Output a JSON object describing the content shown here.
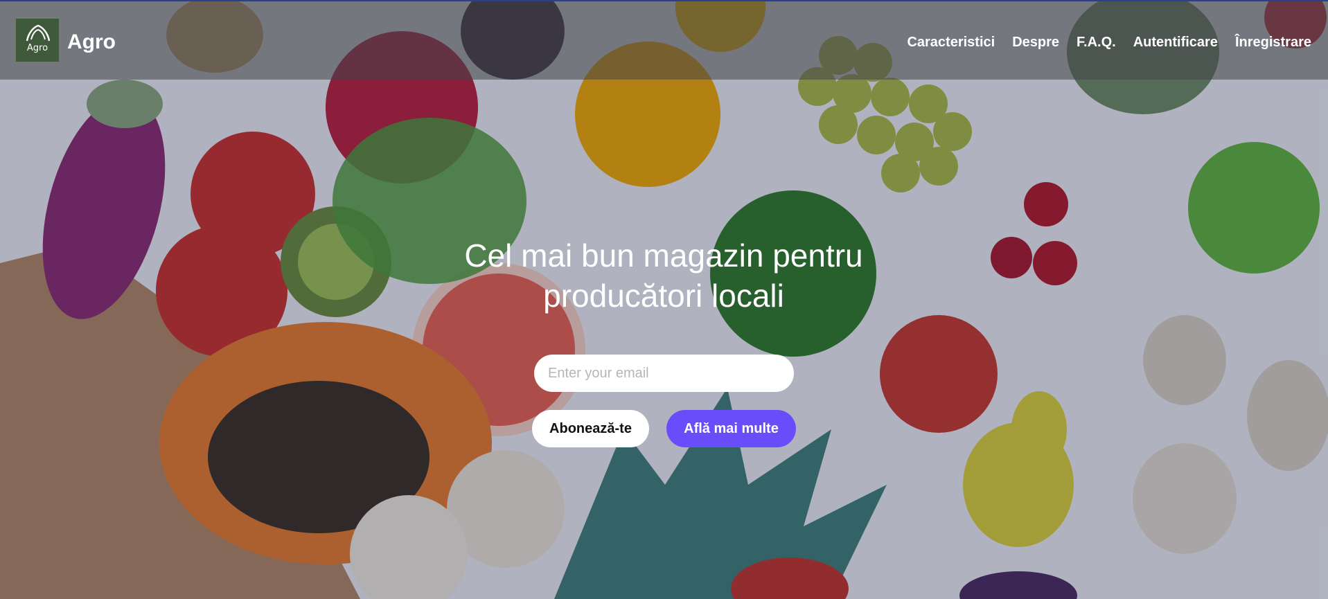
{
  "brand": {
    "logo_text": "Agro",
    "name": "Agro",
    "logo_color": "#3f5a3a"
  },
  "nav": {
    "items": [
      {
        "label": "Caracteristici"
      },
      {
        "label": "Despre"
      },
      {
        "label": "F.A.Q."
      },
      {
        "label": "Autentificare"
      },
      {
        "label": "Înregistrare"
      }
    ]
  },
  "hero": {
    "title_line1": "Cel mai bun magazin pentru",
    "title_line2": "producători locali",
    "email_placeholder": "Enter your email",
    "subscribe_label": "Abonează-te",
    "learn_more_label": "Află mai multe",
    "accent_color": "#6a4dfa"
  }
}
